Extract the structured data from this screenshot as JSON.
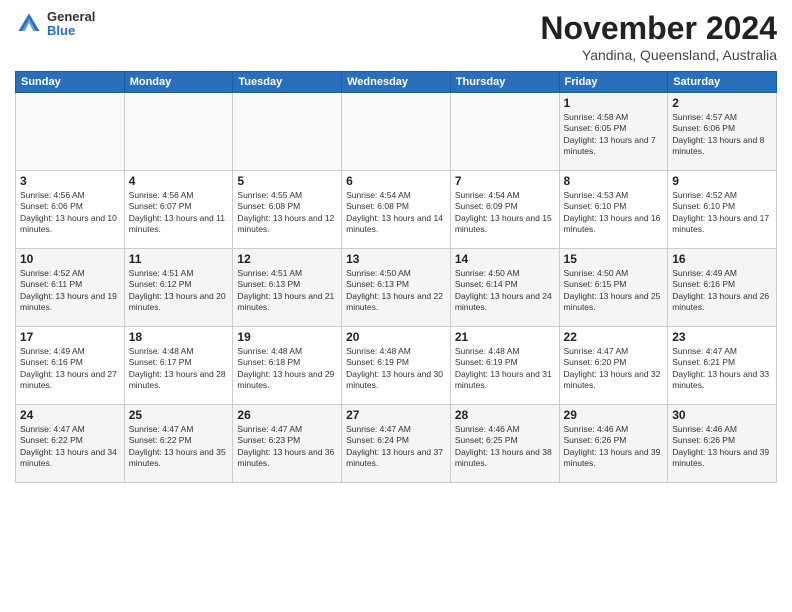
{
  "header": {
    "logo": {
      "general": "General",
      "blue": "Blue"
    },
    "title": "November 2024",
    "location": "Yandina, Queensland, Australia"
  },
  "days_of_week": [
    "Sunday",
    "Monday",
    "Tuesday",
    "Wednesday",
    "Thursday",
    "Friday",
    "Saturday"
  ],
  "weeks": [
    [
      {
        "day": "",
        "info": ""
      },
      {
        "day": "",
        "info": ""
      },
      {
        "day": "",
        "info": ""
      },
      {
        "day": "",
        "info": ""
      },
      {
        "day": "",
        "info": ""
      },
      {
        "day": "1",
        "info": "Sunrise: 4:58 AM\nSunset: 6:05 PM\nDaylight: 13 hours and 7 minutes."
      },
      {
        "day": "2",
        "info": "Sunrise: 4:57 AM\nSunset: 6:06 PM\nDaylight: 13 hours and 8 minutes."
      }
    ],
    [
      {
        "day": "3",
        "info": "Sunrise: 4:56 AM\nSunset: 6:06 PM\nDaylight: 13 hours and 10 minutes."
      },
      {
        "day": "4",
        "info": "Sunrise: 4:56 AM\nSunset: 6:07 PM\nDaylight: 13 hours and 11 minutes."
      },
      {
        "day": "5",
        "info": "Sunrise: 4:55 AM\nSunset: 6:08 PM\nDaylight: 13 hours and 12 minutes."
      },
      {
        "day": "6",
        "info": "Sunrise: 4:54 AM\nSunset: 6:08 PM\nDaylight: 13 hours and 14 minutes."
      },
      {
        "day": "7",
        "info": "Sunrise: 4:54 AM\nSunset: 6:09 PM\nDaylight: 13 hours and 15 minutes."
      },
      {
        "day": "8",
        "info": "Sunrise: 4:53 AM\nSunset: 6:10 PM\nDaylight: 13 hours and 16 minutes."
      },
      {
        "day": "9",
        "info": "Sunrise: 4:52 AM\nSunset: 6:10 PM\nDaylight: 13 hours and 17 minutes."
      }
    ],
    [
      {
        "day": "10",
        "info": "Sunrise: 4:52 AM\nSunset: 6:11 PM\nDaylight: 13 hours and 19 minutes."
      },
      {
        "day": "11",
        "info": "Sunrise: 4:51 AM\nSunset: 6:12 PM\nDaylight: 13 hours and 20 minutes."
      },
      {
        "day": "12",
        "info": "Sunrise: 4:51 AM\nSunset: 6:13 PM\nDaylight: 13 hours and 21 minutes."
      },
      {
        "day": "13",
        "info": "Sunrise: 4:50 AM\nSunset: 6:13 PM\nDaylight: 13 hours and 22 minutes."
      },
      {
        "day": "14",
        "info": "Sunrise: 4:50 AM\nSunset: 6:14 PM\nDaylight: 13 hours and 24 minutes."
      },
      {
        "day": "15",
        "info": "Sunrise: 4:50 AM\nSunset: 6:15 PM\nDaylight: 13 hours and 25 minutes."
      },
      {
        "day": "16",
        "info": "Sunrise: 4:49 AM\nSunset: 6:16 PM\nDaylight: 13 hours and 26 minutes."
      }
    ],
    [
      {
        "day": "17",
        "info": "Sunrise: 4:49 AM\nSunset: 6:16 PM\nDaylight: 13 hours and 27 minutes."
      },
      {
        "day": "18",
        "info": "Sunrise: 4:48 AM\nSunset: 6:17 PM\nDaylight: 13 hours and 28 minutes."
      },
      {
        "day": "19",
        "info": "Sunrise: 4:48 AM\nSunset: 6:18 PM\nDaylight: 13 hours and 29 minutes."
      },
      {
        "day": "20",
        "info": "Sunrise: 4:48 AM\nSunset: 6:19 PM\nDaylight: 13 hours and 30 minutes."
      },
      {
        "day": "21",
        "info": "Sunrise: 4:48 AM\nSunset: 6:19 PM\nDaylight: 13 hours and 31 minutes."
      },
      {
        "day": "22",
        "info": "Sunrise: 4:47 AM\nSunset: 6:20 PM\nDaylight: 13 hours and 32 minutes."
      },
      {
        "day": "23",
        "info": "Sunrise: 4:47 AM\nSunset: 6:21 PM\nDaylight: 13 hours and 33 minutes."
      }
    ],
    [
      {
        "day": "24",
        "info": "Sunrise: 4:47 AM\nSunset: 6:22 PM\nDaylight: 13 hours and 34 minutes."
      },
      {
        "day": "25",
        "info": "Sunrise: 4:47 AM\nSunset: 6:22 PM\nDaylight: 13 hours and 35 minutes."
      },
      {
        "day": "26",
        "info": "Sunrise: 4:47 AM\nSunset: 6:23 PM\nDaylight: 13 hours and 36 minutes."
      },
      {
        "day": "27",
        "info": "Sunrise: 4:47 AM\nSunset: 6:24 PM\nDaylight: 13 hours and 37 minutes."
      },
      {
        "day": "28",
        "info": "Sunrise: 4:46 AM\nSunset: 6:25 PM\nDaylight: 13 hours and 38 minutes."
      },
      {
        "day": "29",
        "info": "Sunrise: 4:46 AM\nSunset: 6:26 PM\nDaylight: 13 hours and 39 minutes."
      },
      {
        "day": "30",
        "info": "Sunrise: 4:46 AM\nSunset: 6:26 PM\nDaylight: 13 hours and 39 minutes."
      }
    ]
  ]
}
